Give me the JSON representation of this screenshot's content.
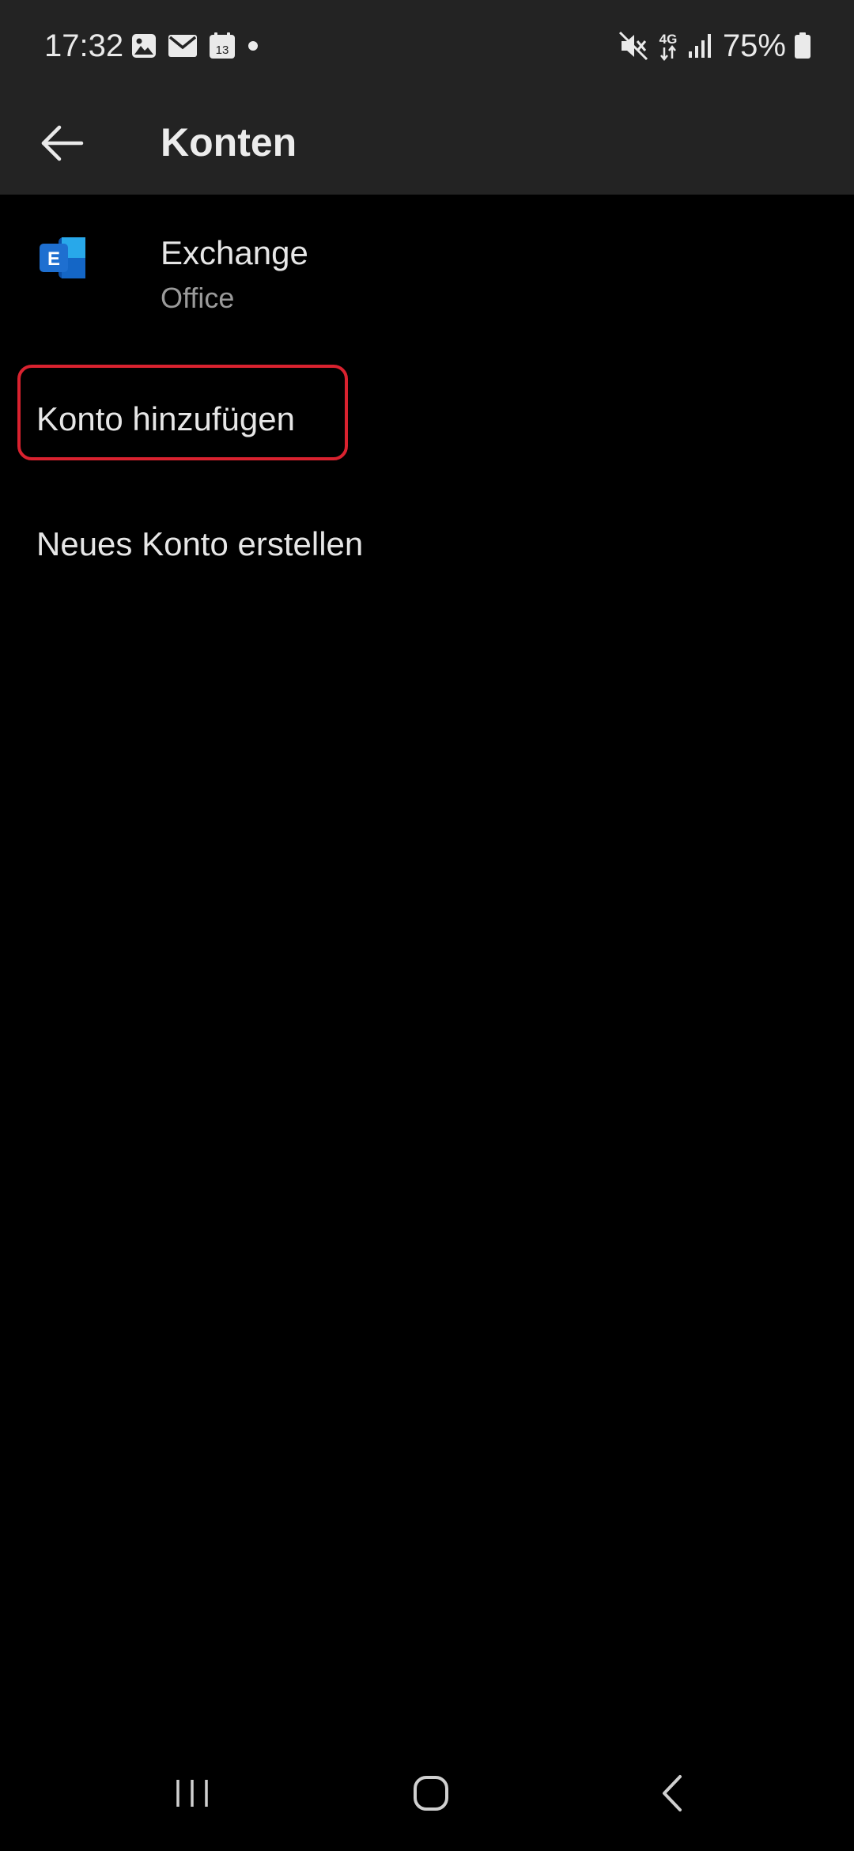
{
  "status_bar": {
    "time": "17:32",
    "calendar_day": "13",
    "network_type": "4G",
    "battery_percent": "75%",
    "icons_left": [
      "image-icon",
      "mail-icon",
      "calendar-icon",
      "dot-icon"
    ],
    "icons_right": [
      "mute-icon",
      "network-4g-icon",
      "signal-icon",
      "battery-icon"
    ]
  },
  "app_bar": {
    "title": "Konten",
    "back_icon": "arrow-left-icon"
  },
  "accounts": [
    {
      "name": "Exchange",
      "type": "Office",
      "icon": "exchange-icon",
      "icon_letter": "E"
    }
  ],
  "actions": {
    "add_account": "Konto hinzufügen",
    "create_account": "Neues Konto erstellen"
  },
  "highlight_color": "#d9222f",
  "colors": {
    "top_bar_bg": "#232323",
    "background": "#000000",
    "exchange_blue": "#1e6fd0"
  },
  "nav_bar": {
    "icons": [
      "recents-icon",
      "home-icon",
      "back-icon"
    ]
  }
}
